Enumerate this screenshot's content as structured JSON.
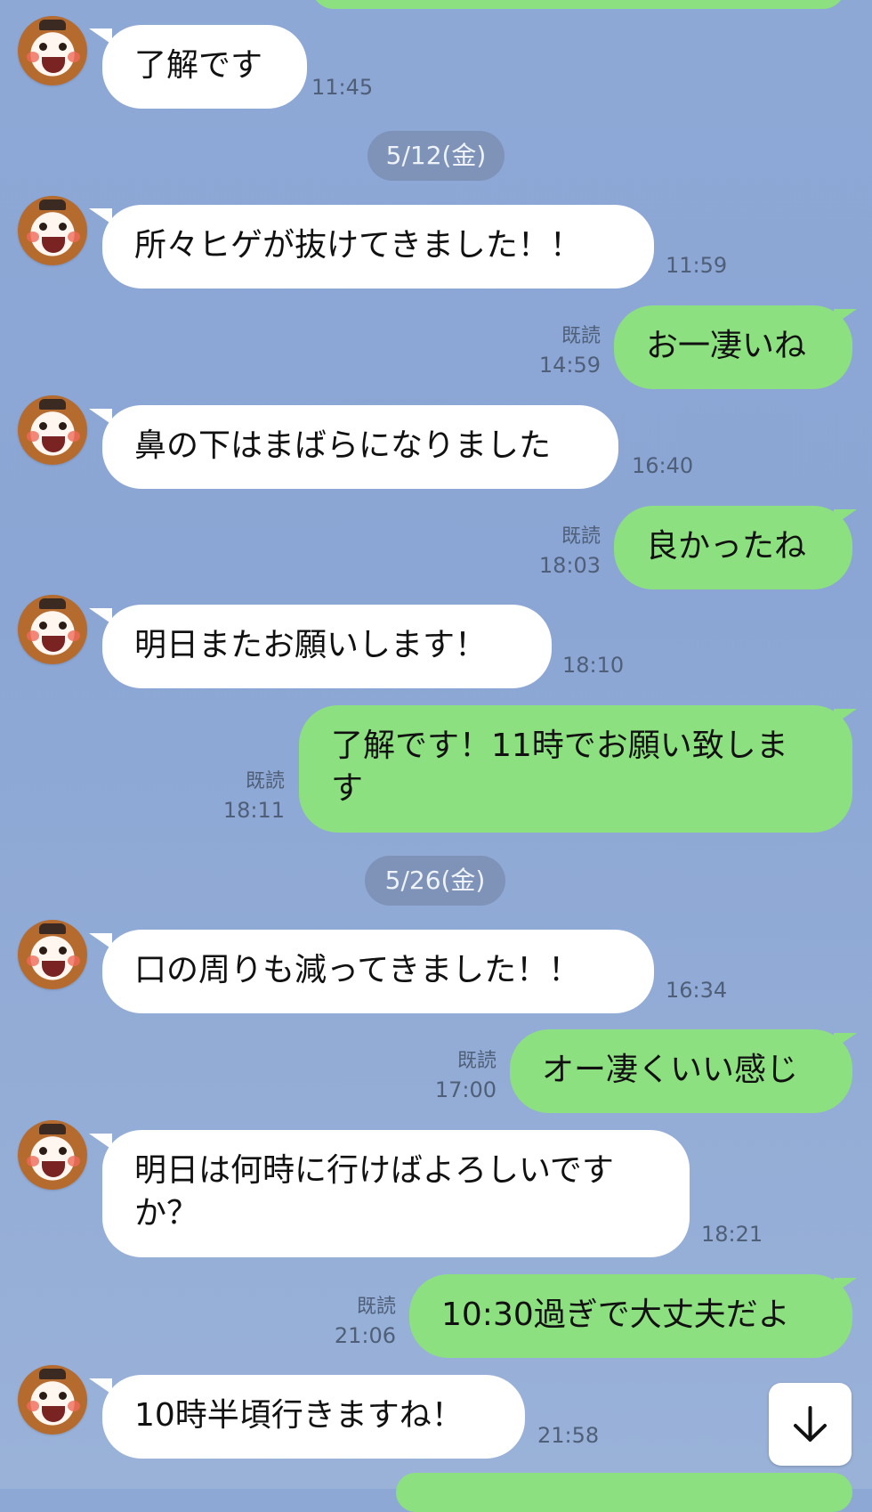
{
  "messages": [
    {
      "text": "了解です",
      "time": "11:45"
    },
    {
      "date": "5/12(金)"
    },
    {
      "text": "所々ヒゲが抜けてきました！！",
      "time": "11:59"
    },
    {
      "text": "お一凄いね",
      "time": "14:59",
      "read": "既読"
    },
    {
      "text": "鼻の下はまばらになりました",
      "time": "16:40"
    },
    {
      "text": "良かったね",
      "time": "18:03",
      "read": "既読"
    },
    {
      "text": "明日またお願いします！",
      "time": "18:10"
    },
    {
      "text_line1": "了解です！11時でお願い致しま",
      "text_line2": "す",
      "time": "18:11",
      "read": "既読"
    },
    {
      "date": "5/26(金)"
    },
    {
      "text": "口の周りも減ってきました！！",
      "time": "16:34"
    },
    {
      "text": "オー凄くいい感じ",
      "time": "17:00",
      "read": "既読"
    },
    {
      "text_line1": "明日は何時に行けばよろしいです",
      "text_line2": "か？",
      "time": "18:21"
    },
    {
      "text": "10:30過ぎで大丈夫だよ",
      "time": "21:06",
      "read": "既読"
    },
    {
      "text": "10時半頃行きますね！",
      "time": "21:58"
    }
  ],
  "icons": {
    "scroll_down": "arrow-down-icon",
    "avatar": "mascot-avatar-icon"
  },
  "colors": {
    "background": "#8ea8d6",
    "incoming": "#ffffff",
    "outgoing": "#8de07f",
    "date_pill": "#7f93b8"
  }
}
